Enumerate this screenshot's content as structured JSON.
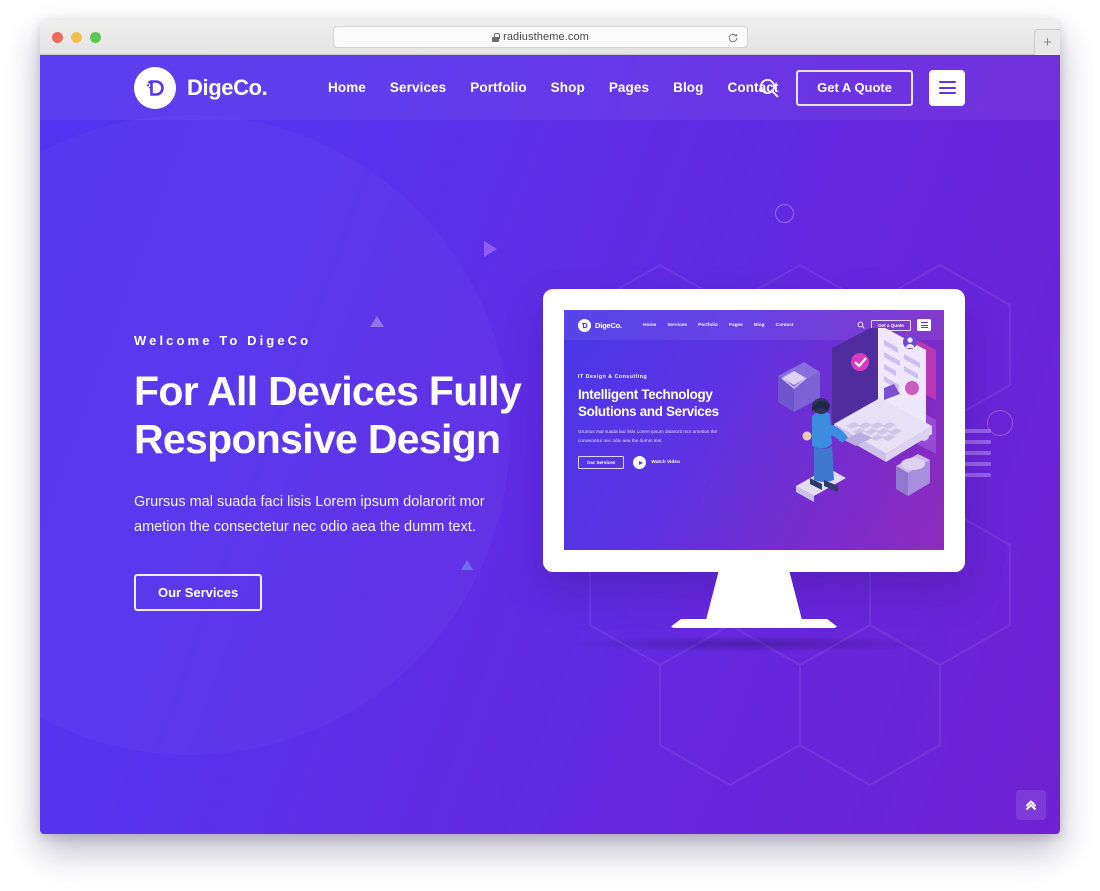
{
  "browser": {
    "url": "radiustheme.com",
    "lock_icon": "lock-icon",
    "reload_icon": "reload-icon",
    "new_tab_label": "+",
    "traffic_lights": [
      "close-red",
      "minimize-yellow",
      "maximize-green"
    ]
  },
  "header": {
    "logo_text": "DigeCo.",
    "logo_icon": "digeco-logo-icon",
    "nav": [
      {
        "label": "Home"
      },
      {
        "label": "Services"
      },
      {
        "label": "Portfolio"
      },
      {
        "label": "Shop"
      },
      {
        "label": "Pages"
      },
      {
        "label": "Blog"
      },
      {
        "label": "Contact"
      }
    ],
    "search_icon": "search-icon",
    "quote_button": "Get A Quote",
    "menu_icon": "hamburger-menu-icon"
  },
  "hero": {
    "eyebrow": "Welcome To DigeCo",
    "title_line1": "For All Devices Fully",
    "title_line2": "Responsive Design",
    "description": "Grursus mal suada faci lisis Lorem ipsum dolarorit mor ametion the consectetur nec odio aea the dumm text.",
    "cta_label": "Our Services"
  },
  "mockup": {
    "device": "desktop-monitor",
    "inner_site": {
      "logo_text": "DigeCo.",
      "nav": [
        {
          "label": "Home"
        },
        {
          "label": "Services"
        },
        {
          "label": "Portfolio"
        },
        {
          "label": "Pages"
        },
        {
          "label": "Blog"
        },
        {
          "label": "Contact"
        }
      ],
      "search_icon": "search-icon",
      "quote_button": "Get a Quote",
      "menu_icon": "hamburger-menu-icon",
      "eyebrow": "IT Design & Consulting",
      "title_line1": "Intelligent Technology",
      "title_line2": "Solutions and Services",
      "description": "Grursus mal suada faci lisis Lorem ipsum dolarorit mor ametion the consectetur nec odio aea the dumm text.",
      "cta_label": "Our Services",
      "video_label": "Watch Video",
      "play_icon": "play-icon",
      "illustration": "isometric-developer-at-laptop"
    }
  },
  "decorations": {
    "circle_outline": "circle-outline-shape",
    "triangle_right": "triangle-right-shape",
    "triangle_up_grey": "triangle-up-shape",
    "triangle_up_blue": "triangle-up-shape",
    "ring_pink": "ring-outline-shape",
    "stacked_lines": "stacked-lines-shape"
  },
  "scroll_top": {
    "icon": "double-chevron-up-icon"
  },
  "colors": {
    "bg_left": "#5133EE",
    "bg_right": "#6F21D3",
    "accent_white": "#FFFFFF",
    "screen_left": "#4A37E8",
    "screen_right": "#8F2BBD",
    "pink_ring": "#E278BE"
  }
}
